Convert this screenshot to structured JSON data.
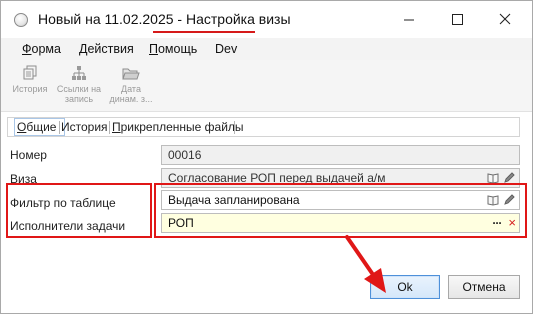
{
  "window": {
    "title_main": "Новый на 11.02.2025 - ",
    "title_highlight": "Настройка визы"
  },
  "menu": {
    "form": {
      "underlined": "Ф",
      "rest": "орма"
    },
    "actions": {
      "underlined": "Д",
      "rest": "ействия"
    },
    "help": {
      "underlined": "П",
      "rest": "омощь"
    },
    "dev": "Dev"
  },
  "toolbar": {
    "history": {
      "line1": "История",
      "line2": ""
    },
    "links": {
      "line1": "Ссылки на",
      "line2": "запись"
    },
    "date": {
      "line1": "Дата",
      "line2": "динам. з..."
    }
  },
  "tabs": {
    "general": {
      "underlined": "О",
      "rest": "бщие"
    },
    "history": "История",
    "attachments": {
      "underlined": "П",
      "rest": "рикрепленные файлы"
    }
  },
  "form": {
    "number": {
      "label": "Номер",
      "value": "00016"
    },
    "visa": {
      "label": "Виза",
      "value": "Согласование РОП перед выдачей а/м"
    },
    "filter": {
      "label": "Фильтр по таблице",
      "value": "Выдача  запланирована"
    },
    "executors": {
      "label": "Исполнители задачи",
      "value": "РОП",
      "dots": "···",
      "clear": "×"
    }
  },
  "buttons": {
    "ok": "Ok",
    "cancel": "Отмена"
  },
  "colors": {
    "annotation": "#e01717",
    "ok_border": "#4e90d9",
    "required_field": "#ffffe0"
  }
}
